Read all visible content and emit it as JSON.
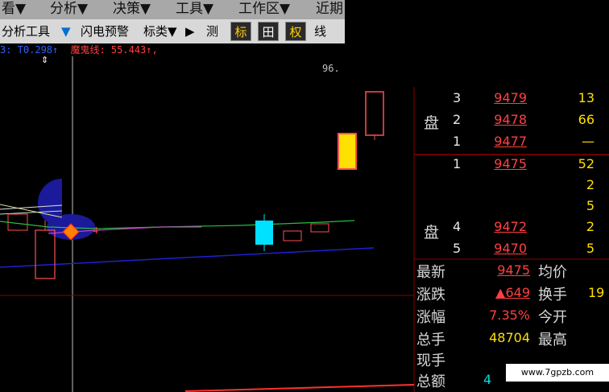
{
  "menu": [
    "看▼",
    "分析▼",
    "决策▼",
    "工具▼",
    "工作区▼",
    "近期"
  ],
  "toolbar": {
    "analysis_tools": "分析工具",
    "dropdown_arrow": "▼",
    "flash_alert": "闪电预警",
    "mark_type": "标类▼",
    "play": "▶",
    "measure": "测",
    "mark": "标",
    "grid": "田",
    "rights": "权",
    "line": "线"
  },
  "indicator": {
    "prefix": "3: T0.298↑",
    "demon_line": "魔鬼线: 55.443↑,"
  },
  "chart": {
    "price_label": "96."
  },
  "order_book": {
    "sell_side_label": "盘",
    "buy_side_label": "盘",
    "sell": [
      {
        "level": "3",
        "price": "9479",
        "volume": "13"
      },
      {
        "level": "2",
        "price": "9478",
        "volume": "66"
      },
      {
        "level": "1",
        "price": "9477",
        "volume": "—"
      }
    ],
    "buy": [
      {
        "level": "1",
        "price": "9475",
        "volume": "52"
      },
      {
        "level": "",
        "price": "",
        "volume": "2"
      },
      {
        "level": "",
        "price": "",
        "volume": "5"
      },
      {
        "level": "4",
        "price": "9472",
        "volume": "2"
      },
      {
        "level": "5",
        "price": "9470",
        "volume": "5"
      }
    ]
  },
  "stats": {
    "latest_label": "最新",
    "latest_value": "9475",
    "avg_label": "均价",
    "change_label": "涨跌",
    "change_value": "▲649",
    "turnover_label": "换手",
    "turnover_value": "19",
    "change_pct_label": "涨幅",
    "change_pct_value": "7.35%",
    "open_label": "今开",
    "total_vol_label": "总手",
    "total_vol_value": "48704",
    "high_label": "最高",
    "current_label": "现手",
    "amount_label": "总额",
    "amount_value": "4"
  },
  "watermark": "www.7gpzb.com",
  "colors": {
    "up": "#ff4040",
    "down": "#00e0e0",
    "ma_blue": "#2020d0",
    "ma_green": "#20c040",
    "volume_yellow": "#ffe000"
  }
}
